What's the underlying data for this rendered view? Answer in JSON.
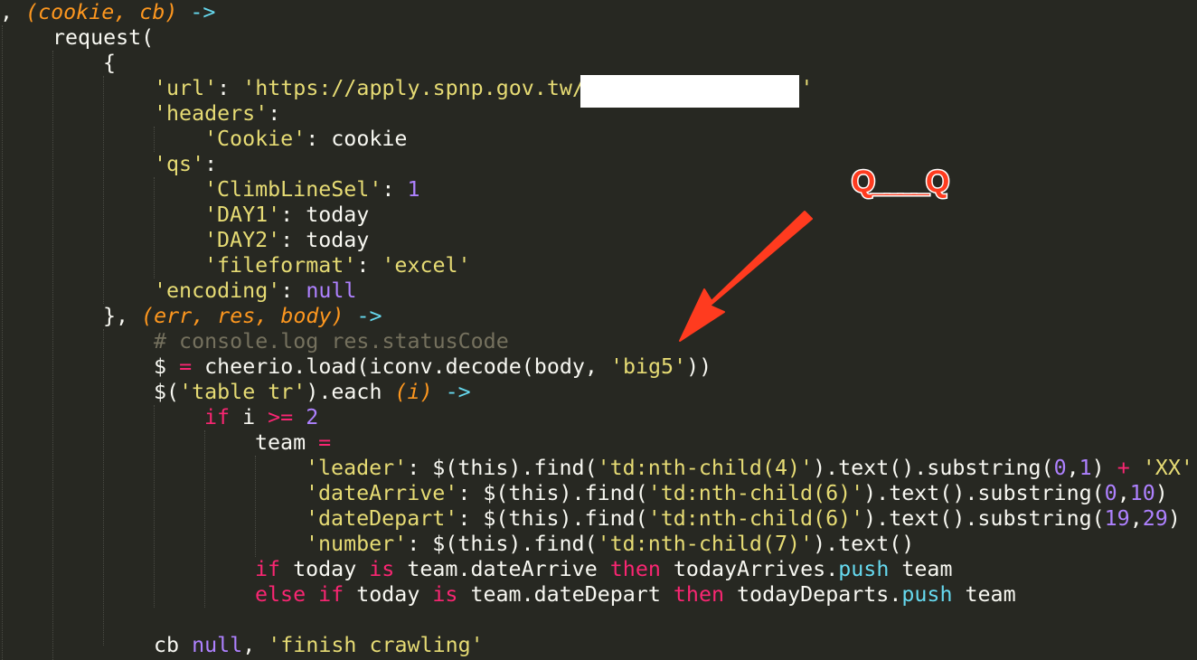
{
  "code_lines": [
    {
      "tokens": [
        {
          "t": ", ",
          "c": "plain"
        },
        {
          "t": "(cookie, cb)",
          "c": "param"
        },
        {
          "t": " ",
          "c": "plain"
        },
        {
          "t": "->",
          "c": "arrow"
        }
      ]
    },
    {
      "tokens": [
        {
          "t": "request(",
          "c": "plain"
        }
      ]
    },
    {
      "tokens": [
        {
          "t": "{",
          "c": "plain"
        }
      ]
    },
    {
      "tokens": [
        {
          "t": "'url'",
          "c": "str"
        },
        {
          "t": ": ",
          "c": "plain"
        },
        {
          "t": "'https://apply.spnp.gov.tw/",
          "c": "str"
        },
        {
          "t": "                 ",
          "c": "plain"
        },
        {
          "t": "'",
          "c": "str"
        }
      ]
    },
    {
      "tokens": [
        {
          "t": "'headers'",
          "c": "str"
        },
        {
          "t": ":",
          "c": "plain"
        }
      ]
    },
    {
      "tokens": [
        {
          "t": "'Cookie'",
          "c": "str"
        },
        {
          "t": ": cookie",
          "c": "plain"
        }
      ]
    },
    {
      "tokens": [
        {
          "t": "'qs'",
          "c": "str"
        },
        {
          "t": ":",
          "c": "plain"
        }
      ]
    },
    {
      "tokens": [
        {
          "t": "'ClimbLineSel'",
          "c": "str"
        },
        {
          "t": ": ",
          "c": "plain"
        },
        {
          "t": "1",
          "c": "num"
        }
      ]
    },
    {
      "tokens": [
        {
          "t": "'DAY1'",
          "c": "str"
        },
        {
          "t": ": today",
          "c": "plain"
        }
      ]
    },
    {
      "tokens": [
        {
          "t": "'DAY2'",
          "c": "str"
        },
        {
          "t": ": today",
          "c": "plain"
        }
      ]
    },
    {
      "tokens": [
        {
          "t": "'fileformat'",
          "c": "str"
        },
        {
          "t": ": ",
          "c": "plain"
        },
        {
          "t": "'excel'",
          "c": "str"
        }
      ]
    },
    {
      "tokens": [
        {
          "t": "'encoding'",
          "c": "str"
        },
        {
          "t": ": ",
          "c": "plain"
        },
        {
          "t": "null",
          "c": "num"
        }
      ]
    },
    {
      "tokens": [
        {
          "t": "}, ",
          "c": "plain"
        },
        {
          "t": "(err, res, body)",
          "c": "param"
        },
        {
          "t": " ",
          "c": "plain"
        },
        {
          "t": "->",
          "c": "arrow"
        }
      ]
    },
    {
      "tokens": [
        {
          "t": "# console.log res.statusCode",
          "c": "comment"
        }
      ]
    },
    {
      "tokens": [
        {
          "t": "$ ",
          "c": "plain"
        },
        {
          "t": "=",
          "c": "kw"
        },
        {
          "t": " cheerio.load(iconv.decode(body, ",
          "c": "plain"
        },
        {
          "t": "'big5'",
          "c": "str"
        },
        {
          "t": "))",
          "c": "plain"
        }
      ]
    },
    {
      "tokens": [
        {
          "t": "$(",
          "c": "plain"
        },
        {
          "t": "'table tr'",
          "c": "str"
        },
        {
          "t": ").each ",
          "c": "plain"
        },
        {
          "t": "(i)",
          "c": "param"
        },
        {
          "t": " ",
          "c": "plain"
        },
        {
          "t": "->",
          "c": "arrow"
        }
      ]
    },
    {
      "tokens": [
        {
          "t": "if",
          "c": "kw"
        },
        {
          "t": " i ",
          "c": "plain"
        },
        {
          "t": ">=",
          "c": "kw"
        },
        {
          "t": " ",
          "c": "plain"
        },
        {
          "t": "2",
          "c": "num"
        }
      ]
    },
    {
      "tokens": [
        {
          "t": "team ",
          "c": "plain"
        },
        {
          "t": "=",
          "c": "kw"
        }
      ]
    },
    {
      "tokens": [
        {
          "t": "'leader'",
          "c": "str"
        },
        {
          "t": ": $(this).find(",
          "c": "plain"
        },
        {
          "t": "'td:nth-child(4)'",
          "c": "str"
        },
        {
          "t": ").text().substring(",
          "c": "plain"
        },
        {
          "t": "0",
          "c": "num"
        },
        {
          "t": ",",
          "c": "plain"
        },
        {
          "t": "1",
          "c": "num"
        },
        {
          "t": ") ",
          "c": "plain"
        },
        {
          "t": "+",
          "c": "kw"
        },
        {
          "t": " ",
          "c": "plain"
        },
        {
          "t": "'XX'",
          "c": "str"
        }
      ]
    },
    {
      "tokens": [
        {
          "t": "'dateArrive'",
          "c": "str"
        },
        {
          "t": ": $(this).find(",
          "c": "plain"
        },
        {
          "t": "'td:nth-child(6)'",
          "c": "str"
        },
        {
          "t": ").text().substring(",
          "c": "plain"
        },
        {
          "t": "0",
          "c": "num"
        },
        {
          "t": ",",
          "c": "plain"
        },
        {
          "t": "10",
          "c": "num"
        },
        {
          "t": ")",
          "c": "plain"
        }
      ]
    },
    {
      "tokens": [
        {
          "t": "'dateDepart'",
          "c": "str"
        },
        {
          "t": ": $(this).find(",
          "c": "plain"
        },
        {
          "t": "'td:nth-child(6)'",
          "c": "str"
        },
        {
          "t": ").text().substring(",
          "c": "plain"
        },
        {
          "t": "19",
          "c": "num"
        },
        {
          "t": ",",
          "c": "plain"
        },
        {
          "t": "29",
          "c": "num"
        },
        {
          "t": ")",
          "c": "plain"
        }
      ]
    },
    {
      "tokens": [
        {
          "t": "'number'",
          "c": "str"
        },
        {
          "t": ": $(this).find(",
          "c": "plain"
        },
        {
          "t": "'td:nth-child(7)'",
          "c": "str"
        },
        {
          "t": ").text()",
          "c": "plain"
        }
      ]
    },
    {
      "tokens": [
        {
          "t": "if",
          "c": "kw"
        },
        {
          "t": " today ",
          "c": "plain"
        },
        {
          "t": "is",
          "c": "kw"
        },
        {
          "t": " team.dateArrive ",
          "c": "plain"
        },
        {
          "t": "then",
          "c": "kw"
        },
        {
          "t": " todayArrives.",
          "c": "plain"
        },
        {
          "t": "push",
          "c": "fn"
        },
        {
          "t": " team",
          "c": "plain"
        }
      ]
    },
    {
      "tokens": [
        {
          "t": "else if",
          "c": "kw"
        },
        {
          "t": " today ",
          "c": "plain"
        },
        {
          "t": "is",
          "c": "kw"
        },
        {
          "t": " team.dateDepart ",
          "c": "plain"
        },
        {
          "t": "then",
          "c": "kw"
        },
        {
          "t": " todayDeparts.",
          "c": "plain"
        },
        {
          "t": "push",
          "c": "fn"
        },
        {
          "t": " team",
          "c": "plain"
        }
      ]
    },
    {
      "tokens": []
    },
    {
      "tokens": [
        {
          "t": "cb ",
          "c": "plain"
        },
        {
          "t": "null",
          "c": "num"
        },
        {
          "t": ", ",
          "c": "plain"
        },
        {
          "t": "'finish crawling'",
          "c": "str"
        }
      ]
    }
  ],
  "annotation": {
    "emoticon_text": "Q____Q",
    "arrow_color": "#FF3B1F",
    "redaction_color": "#FFFFFF"
  },
  "theme": {
    "background": "#272822",
    "text": "#F8F8F2",
    "string": "#E6DB74",
    "keyword": "#F92672",
    "number": "#AE81FF",
    "param": "#FD971F",
    "function": "#66D9EF",
    "comment": "#75715E"
  }
}
